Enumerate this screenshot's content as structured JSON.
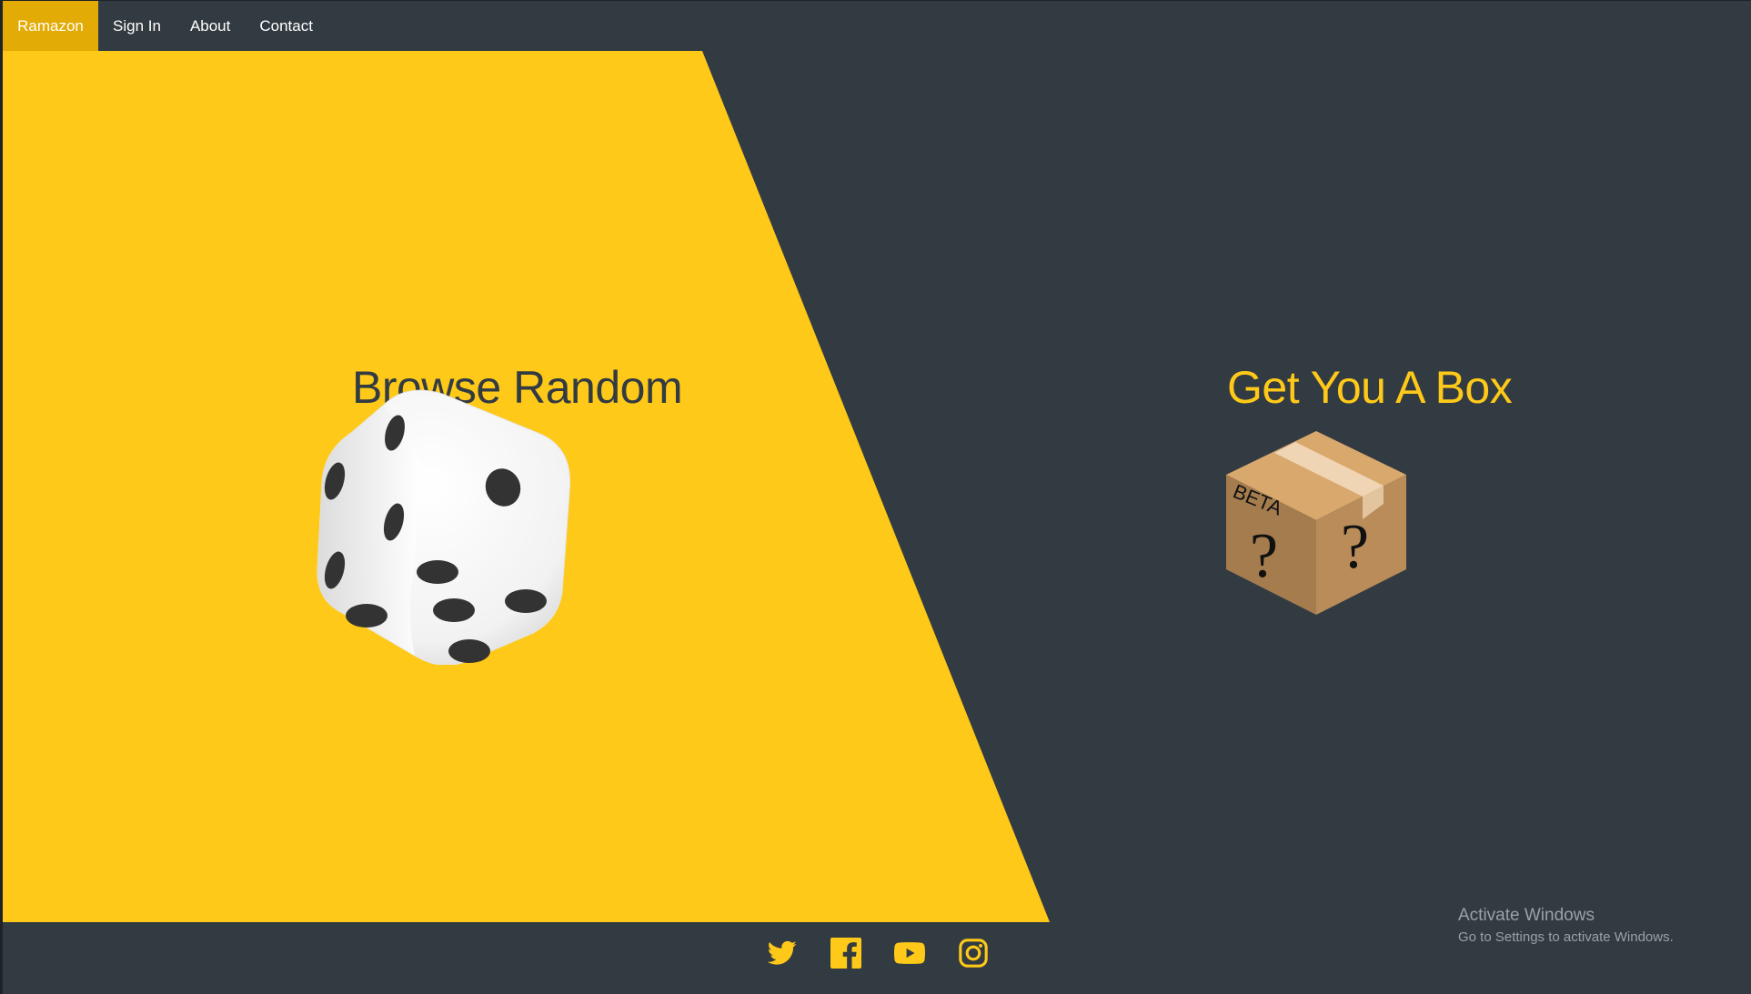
{
  "navbar": {
    "brand": "Ramazon",
    "items": [
      "Sign In",
      "About",
      "Contact"
    ]
  },
  "left_panel": {
    "title": "Browse Random",
    "icon": "dice-icon"
  },
  "right_panel": {
    "title": "Get You A Box",
    "icon": "mystery-box-icon",
    "box_label": "BETA",
    "box_marks": [
      "?",
      "?"
    ]
  },
  "footer": {
    "social": [
      {
        "name": "twitter-icon"
      },
      {
        "name": "facebook-icon"
      },
      {
        "name": "youtube-icon"
      },
      {
        "name": "instagram-icon"
      }
    ]
  },
  "watermark": {
    "line1": "Activate Windows",
    "line2": "Go to Settings to activate Windows."
  },
  "colors": {
    "accent_yellow": "#fec918",
    "brand_active": "#e3ab05",
    "dark_bg": "#333b42"
  }
}
